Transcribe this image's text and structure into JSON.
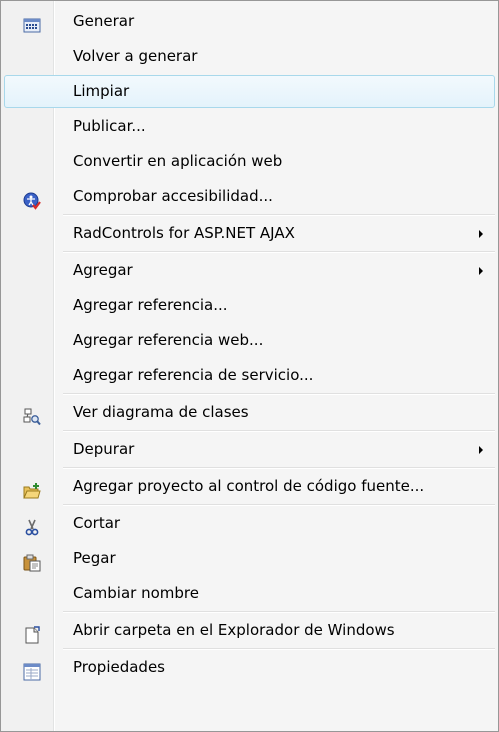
{
  "menu": {
    "items": [
      {
        "label": "Generar",
        "icon": "build-icon"
      },
      {
        "label": "Volver a generar"
      },
      {
        "label": "Limpiar",
        "highlighted": true
      },
      {
        "label": "Publicar..."
      },
      {
        "label": "Convertir en aplicación web"
      },
      {
        "label": "Comprobar accesibilidad...",
        "icon": "accessibility-check-icon"
      },
      {
        "label": "RadControls for ASP.NET AJAX",
        "submenu": true
      },
      {
        "label": "Agregar",
        "submenu": true
      },
      {
        "label": "Agregar referencia..."
      },
      {
        "label": "Agregar referencia web..."
      },
      {
        "label": "Agregar referencia de servicio..."
      },
      {
        "label": "Ver diagrama de clases",
        "icon": "class-diagram-icon"
      },
      {
        "label": "Depurar",
        "submenu": true
      },
      {
        "label": "Agregar proyecto al control de código fuente...",
        "icon": "add-to-source-control-icon"
      },
      {
        "label": "Cortar",
        "icon": "scissors-icon"
      },
      {
        "label": "Pegar",
        "icon": "paste-icon"
      },
      {
        "label": "Cambiar nombre"
      },
      {
        "label": "Abrir carpeta en el Explorador de Windows",
        "icon": "open-folder-icon"
      },
      {
        "label": "Propiedades",
        "icon": "properties-icon"
      }
    ]
  },
  "colors": {
    "highlight_border": "#a8d8eb",
    "menu_background": "#f5f5f5"
  }
}
